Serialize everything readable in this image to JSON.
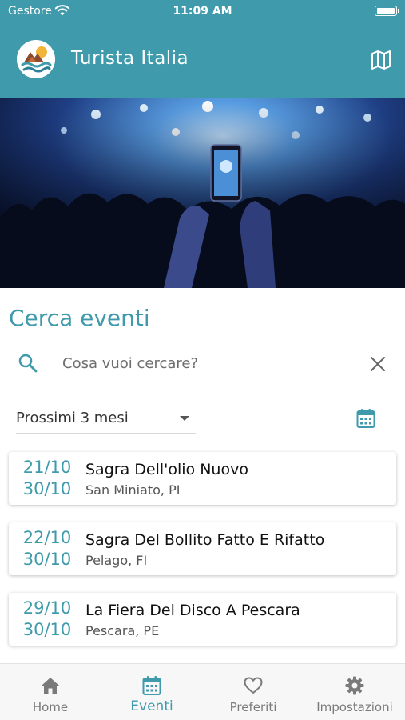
{
  "status_bar": {
    "carrier": "Gestore",
    "time": "11:09 AM"
  },
  "header": {
    "title": "Turista Italia",
    "map_icon": "map-icon",
    "logo": "app-logo"
  },
  "hero": {
    "description_icon": "concert-photo"
  },
  "search": {
    "title": "Cerca eventi",
    "placeholder": "Cosa vuoi cercare?",
    "value": "",
    "period": "Prossimi 3 mesi",
    "period_options": [
      "Prossimi 3 mesi"
    ]
  },
  "events": [
    {
      "start": "21/10",
      "end": "30/10",
      "name": "Sagra Dell'olio Nuovo",
      "place": "San Miniato, PI"
    },
    {
      "start": "22/10",
      "end": "30/10",
      "name": "Sagra Del Bollito Fatto E Rifatto",
      "place": "Pelago, FI"
    },
    {
      "start": "29/10",
      "end": "30/10",
      "name": "La Fiera Del Disco A Pescara",
      "place": "Pescara, PE"
    }
  ],
  "tabs": [
    {
      "label": "Home",
      "icon": "home-icon",
      "active": false
    },
    {
      "label": "Eventi",
      "icon": "calendar-icon",
      "active": true
    },
    {
      "label": "Preferiti",
      "icon": "heart-icon",
      "active": false
    },
    {
      "label": "Impostazioni",
      "icon": "gear-icon",
      "active": false
    }
  ],
  "colors": {
    "accent": "#3f9aac",
    "header_bg": "#3f9aac",
    "inactive_tab": "#7a7a7a"
  }
}
